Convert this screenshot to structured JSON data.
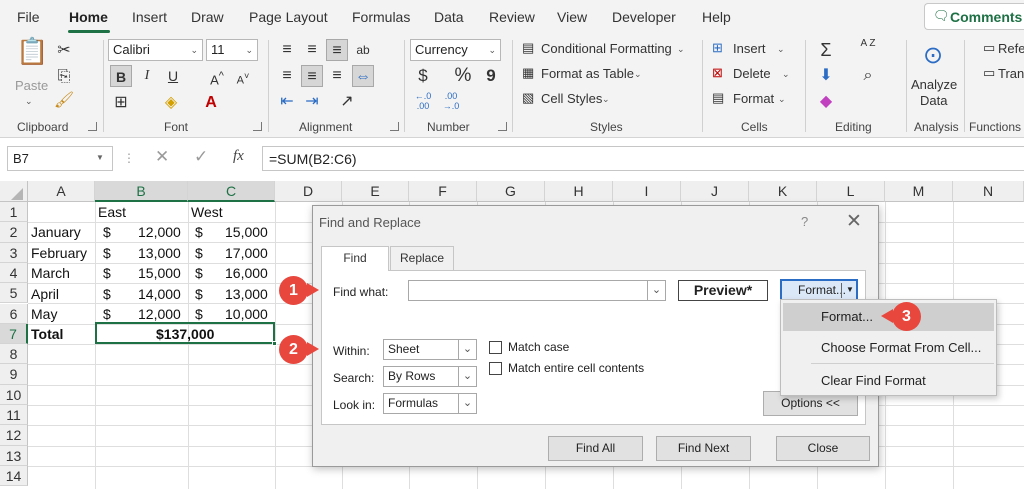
{
  "menu": {
    "tabs": [
      "File",
      "Home",
      "Insert",
      "Draw",
      "Page Layout",
      "Formulas",
      "Data",
      "Review",
      "View",
      "Developer",
      "Help"
    ],
    "comments_label": "Comments"
  },
  "ribbon": {
    "clipboard": {
      "paste": "Paste",
      "label": "Clipboard"
    },
    "font": {
      "name": "Calibri",
      "size": "11",
      "bold": "B",
      "italic": "I",
      "underline": "U",
      "label": "Font"
    },
    "alignment": {
      "label": "Alignment"
    },
    "number": {
      "format": "Currency",
      "dollar": "$",
      "percent": "%",
      "comma": "9",
      "inc_dec": "←.0 .00",
      "dec_dec": ".00 →.0",
      "label": "Number"
    },
    "styles": {
      "conditional": "Conditional Formatting",
      "format_table": "Format as Table",
      "cell_styles": "Cell Styles",
      "label": "Styles"
    },
    "cells": {
      "insert": "Insert",
      "delete": "Delete",
      "format": "Format",
      "label": "Cells"
    },
    "editing": {
      "sum": "Σ",
      "sort": "A Z",
      "label": "Editing"
    },
    "analysis": {
      "analyze": "Analyze",
      "data": "Data",
      "label": "Analysis"
    },
    "functions": {
      "ref1": "Refe",
      "ref2": "Tran",
      "label": "Functions T"
    }
  },
  "formula_bar": {
    "name_box": "B7",
    "cancel": "✕",
    "enter": "✓",
    "fx": "fx",
    "formula": "=SUM(B2:C6)"
  },
  "sheet": {
    "columns": [
      "A",
      "B",
      "C",
      "D",
      "E",
      "F",
      "G",
      "H",
      "I",
      "J",
      "K",
      "L",
      "M",
      "N"
    ],
    "rows": [
      "1",
      "2",
      "3",
      "4",
      "5",
      "6",
      "7",
      "8",
      "9",
      "10",
      "11",
      "12",
      "13",
      "14"
    ],
    "headers": {
      "b": "East",
      "c": "West"
    },
    "data": [
      {
        "month": "January",
        "east": "12,000",
        "west": "15,000"
      },
      {
        "month": "February",
        "east": "13,000",
        "west": "17,000"
      },
      {
        "month": "March",
        "east": "15,000",
        "west": "16,000"
      },
      {
        "month": "April",
        "east": "14,000",
        "west": "13,000"
      },
      {
        "month": "May",
        "east": "12,000",
        "west": "10,000"
      }
    ],
    "currency_symbol": "$",
    "total_label": "Total",
    "total_value": "$137,000"
  },
  "dialog": {
    "title": "Find and Replace",
    "help": "?",
    "close": "✕",
    "tabs": {
      "find": "Find",
      "replace": "Replace"
    },
    "find_what_label": "Find what:",
    "find_what_value": "",
    "preview": "Preview*",
    "format_button": "Format...",
    "within_label": "Within:",
    "within_value": "Sheet",
    "search_label": "Search:",
    "search_value": "By Rows",
    "look_in_label": "Look in:",
    "look_in_value": "Formulas",
    "match_case": "Match case",
    "match_entire": "Match entire cell contents",
    "options_button": "Options <<",
    "find_all": "Find All",
    "find_next": "Find Next",
    "close_button": "Close"
  },
  "format_menu": {
    "items": [
      "Format...",
      "Choose Format From Cell...",
      "Clear Find Format"
    ]
  },
  "badges": [
    "1",
    "2",
    "3"
  ],
  "colors": {
    "accent": "#1e7145",
    "badge": "#e8473e",
    "format_btn_border": "#2b6cc4"
  }
}
